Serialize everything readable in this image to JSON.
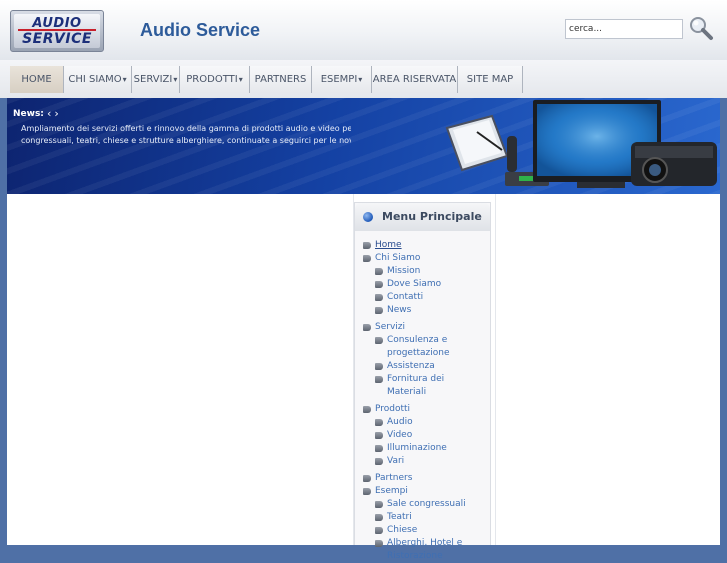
{
  "header": {
    "logo_line1": "AUDIO",
    "logo_line2": "SERVICE",
    "site_title": "Audio Service",
    "search_placeholder": "cerca...",
    "search_icon": "magnifier-icon"
  },
  "nav": {
    "items": [
      {
        "label": "HOME",
        "dropdown": false
      },
      {
        "label": "CHI SIAMO",
        "dropdown": true
      },
      {
        "label": "SERVIZI",
        "dropdown": true
      },
      {
        "label": "PRODOTTI",
        "dropdown": true
      },
      {
        "label": "PARTNERS",
        "dropdown": false
      },
      {
        "label": "ESEMPI",
        "dropdown": true
      },
      {
        "label": "AREA RISERVATA",
        "dropdown": false
      },
      {
        "label": "SITE MAP",
        "dropdown": false
      }
    ],
    "caret": "▾"
  },
  "banner": {
    "news_label": "News:",
    "news_arrows": "‹›",
    "news_line1": "Ampliamento dei servizi offerti e rinnovo della gamma di prodotti audio e video per sale e",
    "news_line2": "congressuali, teatri, chiese e strutture alberghiere, continuate a seguirci per le novità in arrivo nei prossimi mesi e per sapere come andiamo avanti..."
  },
  "menu": {
    "title": "Menu Principale",
    "items": [
      {
        "label": "Home",
        "level": 0
      },
      {
        "label": "Chi Siamo",
        "level": 0
      },
      {
        "label": "Mission",
        "level": 1
      },
      {
        "label": "Dove Siamo",
        "level": 1
      },
      {
        "label": "Contatti",
        "level": 1
      },
      {
        "label": "News",
        "level": 1
      },
      {
        "label": "Servizi",
        "level": 0
      },
      {
        "label": "Consulenza e progettazione",
        "level": 1
      },
      {
        "label": "Assistenza",
        "level": 1
      },
      {
        "label": "Fornitura dei Materiali",
        "level": 1
      },
      {
        "label": "Prodotti",
        "level": 0
      },
      {
        "label": "Audio",
        "level": 1
      },
      {
        "label": "Video",
        "level": 1
      },
      {
        "label": "Illuminazione",
        "level": 1
      },
      {
        "label": "Vari",
        "level": 1
      },
      {
        "label": "Partners",
        "level": 0
      },
      {
        "label": "Esempi",
        "level": 0
      },
      {
        "label": "Sale congressuali",
        "level": 1
      },
      {
        "label": "Teatri",
        "level": 1
      },
      {
        "label": "Chiese",
        "level": 1
      },
      {
        "label": "Alberghi, Hotel e Ristorazione",
        "level": 1
      }
    ]
  },
  "colors": {
    "accent": "#2d5b9a",
    "link": "#3f6fb3",
    "banner_dark": "#0d2470",
    "page_bg": "#4f70a6"
  }
}
